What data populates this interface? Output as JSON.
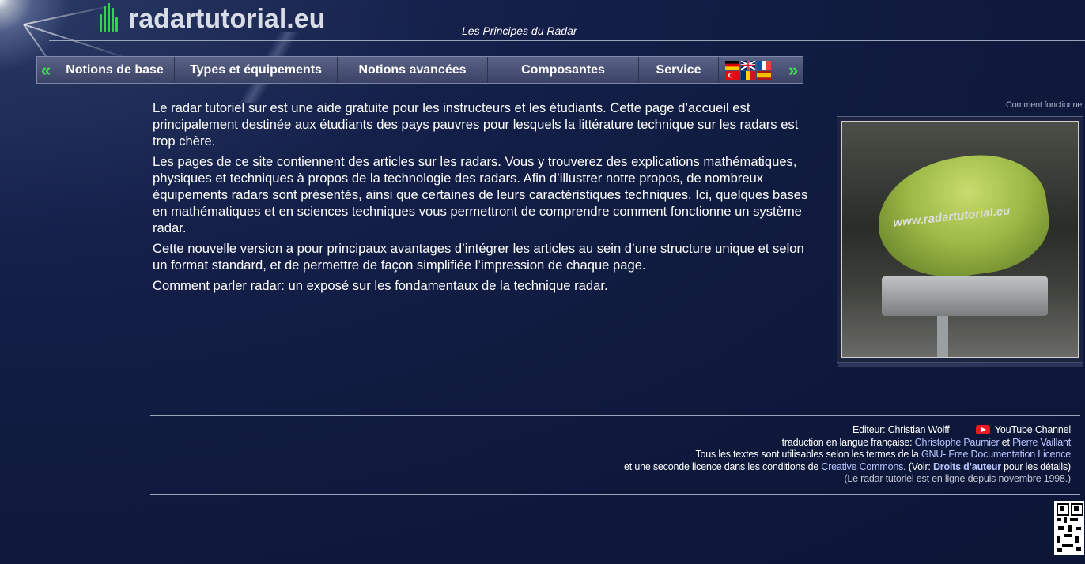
{
  "header": {
    "logo_text": "radartutorial.eu",
    "subtitle": "Les Principes du Radar"
  },
  "nav": {
    "left_arrow": "«",
    "right_arrow": "»",
    "items": [
      {
        "label": "Notions de base"
      },
      {
        "label": "Types et équipements"
      },
      {
        "label": "Notions avancées"
      },
      {
        "label": "Composantes"
      },
      {
        "label": "Service"
      }
    ],
    "flags": [
      "de",
      "gb",
      "fr",
      "tr",
      "ro",
      "es"
    ]
  },
  "main": {
    "paragraphs": [
      "Le radar tutoriel sur est une aide gratuite pour les instructeurs et les étudiants. Cette page d’accueil est principalement destinée aux étudiants des pays pauvres pour lesquels la littérature technique sur les radars est trop chère.",
      "Les pages de ce site contiennent des articles sur les radars. Vous y trouverez des explications mathématiques, physiques et techniques à propos de la technologie des radars. Afin d’illustrer notre propos, de nombreux équipements radars sont présentés, ainsi que certaines de leurs caractéristiques techniques. Ici, quelques bases en mathématiques et en sciences techniques vous permettront de comprendre comment fonctionne un système radar.",
      "Cette nouvelle version a pour principaux avantages d’intégrer les articles au sein d’une structure unique et selon un format standard, et de permettre de façon simplifiée l’impression de chaque page.",
      "Comment parler radar: un exposé sur les fondamentaux de la technique radar."
    ]
  },
  "sidebar": {
    "caption": "Comment fonctionne",
    "photo_text": "www.radartutorial.eu"
  },
  "footer": {
    "editor_label": "Editeur:",
    "editor_name": "Christian Wolff",
    "youtube_label": "YouTube Channel",
    "translation_label": "traduction en langue française:",
    "translator1": "Christophe Paumier",
    "and": "et",
    "translator2": "Pierre Vaillant",
    "license_text": "Tous les textes sont utilisables selon les termes de la",
    "license_link": "GNU- Free Documentation Licence",
    "second_license_text": "et une seconde licence dans les conditions de",
    "cc_link": "Creative Commons",
    "voir_prefix": ". (Voir:",
    "copyright_link": "Droits d’auteur",
    "voir_suffix": "pour les détails)",
    "online_since": "(Le radar tutoriel est en ligne depuis novembre 1998.)"
  },
  "colors": {
    "background": "#0f1a3e",
    "accent_green": "#3be04e",
    "link": "#b9c4ff",
    "youtube_red": "#e21e1e"
  }
}
